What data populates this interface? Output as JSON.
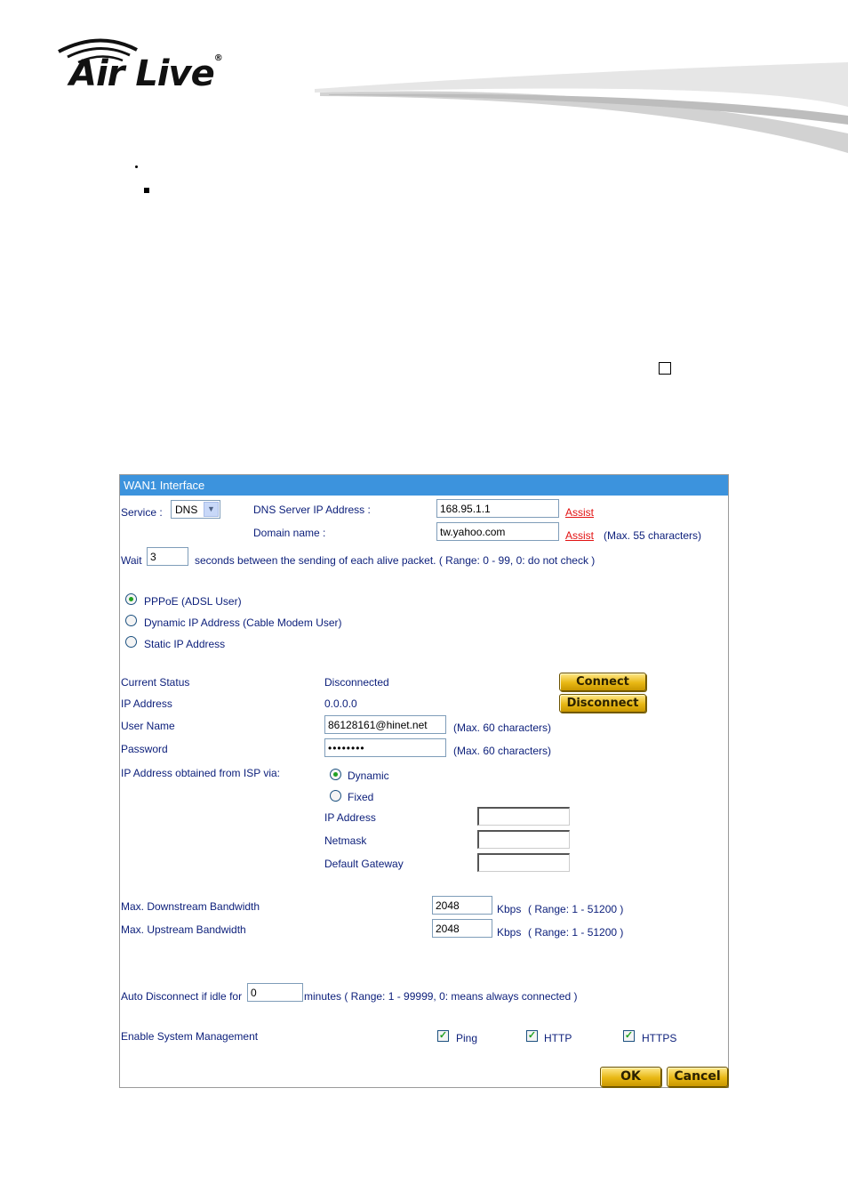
{
  "brand": {
    "name": "Air Live",
    "reg": "®"
  },
  "panel": {
    "title": "WAN1 Interface",
    "service": {
      "label": "Service :",
      "value": "DNS"
    },
    "dns_server": {
      "label": "DNS Server IP Address :",
      "value": "168.95.1.1",
      "assist": "Assist"
    },
    "domain": {
      "label": "Domain name :",
      "value": "tw.yahoo.com",
      "assist": "Assist",
      "hint": "(Max. 55 characters)"
    },
    "wait": {
      "label": "Wait",
      "value": "3",
      "suffix": "seconds between the sending of each alive packet. ( Range: 0 - 99, 0: do not check )"
    },
    "modes": [
      {
        "label": "PPPoE (ADSL User)",
        "selected": true
      },
      {
        "label": "Dynamic IP Address (Cable Modem User)",
        "selected": false
      },
      {
        "label": "Static IP Address",
        "selected": false
      }
    ],
    "status": {
      "label": "Current Status",
      "value": "Disconnected"
    },
    "ip": {
      "label": "IP Address",
      "value": "0.0.0.0"
    },
    "connect_label": "Connect",
    "disconnect_label": "Disconnect",
    "username": {
      "label": "User Name",
      "value": "86128161@hinet.net",
      "hint": "(Max. 60 characters)"
    },
    "password": {
      "label": "Password",
      "value": "••••••••",
      "hint": "(Max. 60 characters)"
    },
    "isp": {
      "label": "IP Address obtained from ISP via:",
      "dynamic": "Dynamic",
      "fixed": "Fixed",
      "ip_label": "IP Address",
      "netmask_label": "Netmask",
      "gateway_label": "Default Gateway"
    },
    "downstream": {
      "label": "Max. Downstream Bandwidth",
      "value": "2048",
      "unit": "Kbps",
      "range": "( Range: 1 - 51200 )"
    },
    "upstream": {
      "label": "Max. Upstream Bandwidth",
      "value": "2048",
      "unit": "Kbps",
      "range": "( Range: 1 - 51200 )"
    },
    "idle": {
      "label": "Auto Disconnect if idle for",
      "value": "0",
      "suffix": "minutes ( Range: 1 - 99999, 0: means always connected )"
    },
    "mgmt": {
      "label": "Enable System Management",
      "ping": "Ping",
      "http": "HTTP",
      "https": "HTTPS"
    },
    "ok_label": "OK",
    "cancel_label": "Cancel"
  },
  "colors": {
    "header": "#3c93dd",
    "label_text": "#0b1e7a",
    "link": "#e21212",
    "button": "#e8b814"
  }
}
